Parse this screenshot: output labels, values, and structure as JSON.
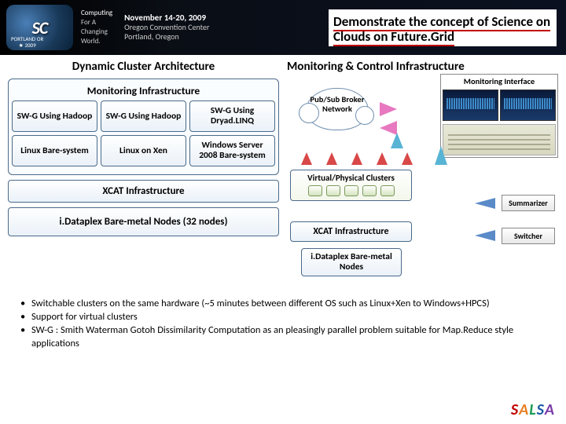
{
  "banner": {
    "logo_text": "SC",
    "logo_city": "PORTLAND",
    "logo_state": "OR",
    "logo_year": "2009",
    "tagline1": "Computing",
    "tagline2": "For A",
    "tagline3": "Changing",
    "tagline4": "World.",
    "conf_date": "November 14-20, 2009",
    "conf_loc1": "Oregon Convention Center",
    "conf_loc2": "Portland, Oregon",
    "title": "Demonstrate the concept of Science on Clouds on Future.Grid"
  },
  "left": {
    "heading": "Dynamic Cluster Architecture",
    "panel_title": "Monitoring Infrastructure",
    "row1": [
      "SW-G Using Hadoop",
      "SW-G Using Hadoop",
      "SW-G Using Dryad.LINQ"
    ],
    "row2": [
      "Linux Bare-system",
      "Linux on Xen",
      "Windows Server 2008 Bare-system"
    ],
    "xcat": "XCAT Infrastructure",
    "idataplex": "i.Dataplex Bare-metal Nodes (32 nodes)"
  },
  "right": {
    "heading": "Monitoring & Control Infrastructure",
    "cloud": "Pub/Sub Broker Network",
    "monitor_head": "Monitoring Interface",
    "vpc": "Virtual/Physical Clusters",
    "xcat": "XCAT Infrastructure",
    "idataplex": "i.Dataplex Bare-metal Nodes",
    "summarizer": "Summarizer",
    "switcher": "Switcher"
  },
  "bullets": {
    "b1": "Switchable clusters on the same hardware (~5 minutes between different OS such as Linux+Xen to Windows+HPCS)",
    "b2": "Support for virtual clusters",
    "b3": "SW-G : Smith Waterman Gotoh Dissimilarity Computation as an pleasingly parallel problem suitable for Map.Reduce style applications"
  },
  "footer": {
    "s": "S",
    "a": "A",
    "l": "L",
    "s2": "S",
    "a2": "A"
  }
}
